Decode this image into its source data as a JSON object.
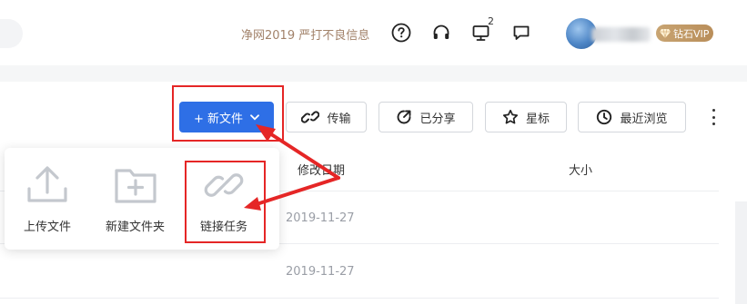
{
  "header": {
    "promo_text": "净网2019 严打不良信息",
    "notification_count": "2",
    "vip_label": "钻石VIP",
    "icons": [
      "help-icon",
      "headset-icon",
      "monitor-icon",
      "message-icon",
      "diamond-icon"
    ]
  },
  "toolbar": {
    "new_file_label": "+ 新文件",
    "transfer_label": "传输",
    "shared_label": "已分享",
    "starred_label": "星标",
    "recent_label": "最近浏览"
  },
  "table": {
    "columns": [
      "修改日期",
      "大小"
    ],
    "rows": [
      {
        "date": "2019-11-27"
      },
      {
        "date": "2019-11-27"
      }
    ]
  },
  "new_menu": {
    "items": [
      {
        "label": "上传文件",
        "icon": "upload-icon"
      },
      {
        "label": "新建文件夹",
        "icon": "new-folder-icon"
      },
      {
        "label": "链接任务",
        "icon": "link-icon"
      }
    ]
  },
  "colors": {
    "primary": "#2e6fe6",
    "annotation_red": "#e52626",
    "vip_gold": "#c8a472",
    "promo_brown": "#a2826a"
  }
}
